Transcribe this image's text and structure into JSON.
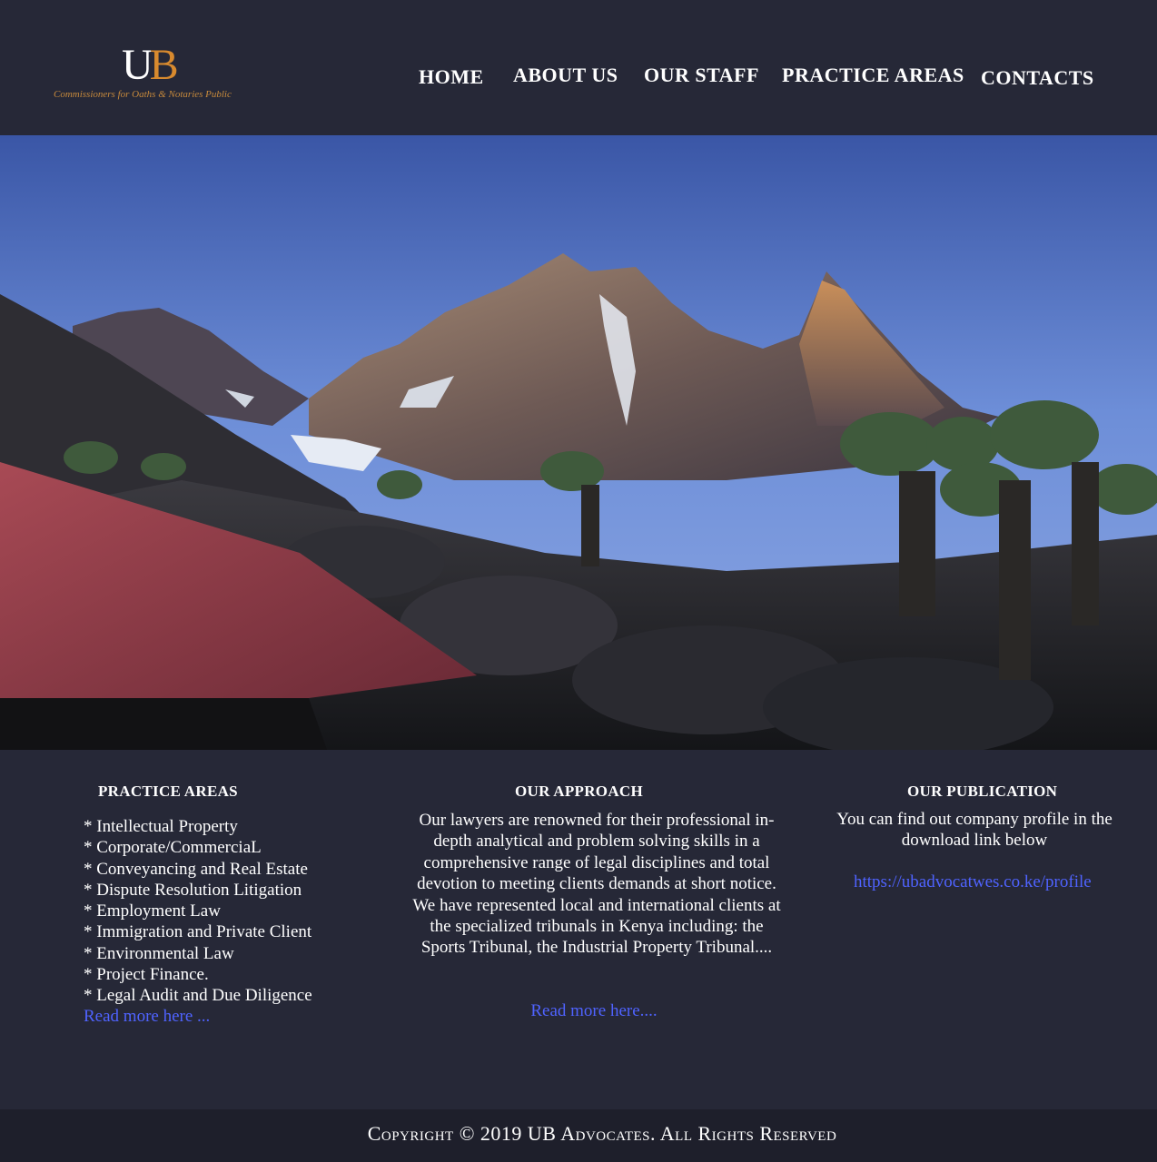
{
  "header": {
    "logo": {
      "mark_u": "U",
      "mark_b": "B",
      "tagline": "Commissioners for Oaths & Notaries Public"
    },
    "nav": {
      "home": "HOME",
      "about": "ABOUT US",
      "staff": "OUR STAFF",
      "practice": "PRACTICE AREAS",
      "contacts": "CONTACTS"
    }
  },
  "hero": {
    "image": "mountain-landscape"
  },
  "practice_areas": {
    "title": "PRACTICE AREAS",
    "items": [
      "* Intellectual Property",
      "* Corporate/CommerciaL",
      "* Conveyancing and Real Estate",
      "* Dispute Resolution Litigation",
      "* Employment Law",
      "* Immigration and Private Client",
      "* Environmental Law",
      "* Project Finance.",
      "* Legal Audit and Due Diligence"
    ],
    "read_more": "Read more here ..."
  },
  "approach": {
    "title": "OUR APPROACH",
    "body": "Our lawyers are renowned for their professional in-depth analytical and problem solving skills in a comprehensive range of legal disciplines and total devotion to meeting clients demands at short notice. We have represented local and international clients at the specialized tribunals in Kenya including: the Sports Tribunal, the Industrial Property Tribunal....",
    "read_more": "Read more here...."
  },
  "publication": {
    "title": "OUR PUBLICATION",
    "body": "You can find out company profile in the download link below",
    "link": "https://ubadvocatwes.co.ke/profile"
  },
  "footer": {
    "copyright": "Copyright © 2019 UB Advocates. All Rights Reserved"
  },
  "colors": {
    "background": "#262837",
    "footer": "#1e1f2b",
    "logo_accent": "#d88a2e",
    "link": "#4f63ff"
  }
}
